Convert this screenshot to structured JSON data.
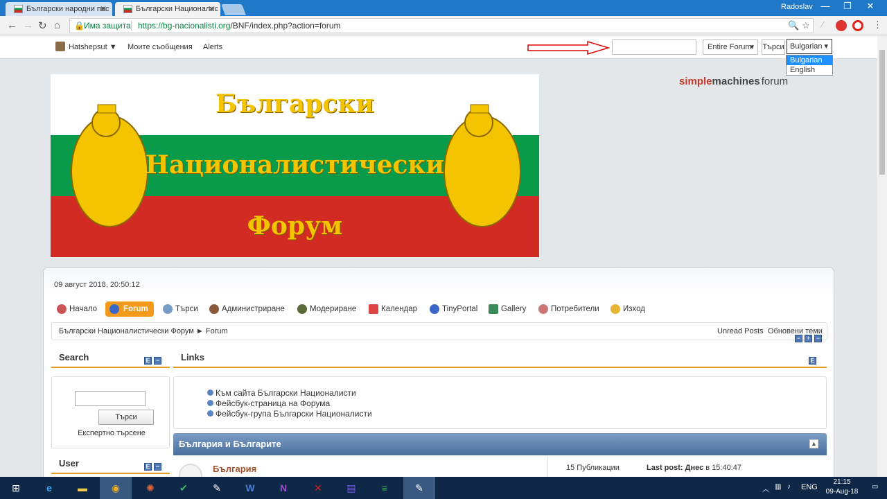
{
  "browser": {
    "tabs": [
      {
        "title": "Български народни пес"
      },
      {
        "title": "Български Националис"
      }
    ],
    "user": "Radoslav",
    "secure_label": "Има защита",
    "url_host": "https://bg-nacionalisti.org",
    "url_path": "/BNF/index.php?action=forum"
  },
  "userbar": {
    "username": "Hatshepsut ▼",
    "my_messages": "Моите съобщения",
    "alerts": "Alerts",
    "search_placeholder": "",
    "scope": "Entire Forum",
    "search_button": "Търси",
    "language_selected": "Bulgarian",
    "language_options": [
      "Bulgarian",
      "English"
    ]
  },
  "banner": {
    "line1": "Български",
    "line2": "Националистически",
    "line3": "Форум",
    "colors": {
      "white": "#ffffff",
      "green": "#0a9b4a",
      "red": "#d22b24",
      "gold": "#f5c400"
    }
  },
  "smf_logo": {
    "part1": "simple",
    "part2": "machines",
    "part3": "forum"
  },
  "forum": {
    "date": "09 август 2018, 20:50:12",
    "menu": [
      "Начало",
      "Forum",
      "Търси",
      "Администриране",
      "Модериране",
      "Календар",
      "TinyPortal",
      "Gallery",
      "Потребители",
      "Изход"
    ],
    "breadcrumb": "Български Националистически Форум ► Forum",
    "unread": "Unread Posts",
    "updated": "Обновени теми"
  },
  "search_block": {
    "title": "Search",
    "button": "Търси",
    "advanced": "Експертно търсене"
  },
  "user_block": {
    "title": "User"
  },
  "links_block": {
    "title": "Links",
    "items": [
      "Към сайта Български Националисти",
      "Фейсбук-страница на Форума",
      "Фейсбук-група Български Националисти"
    ]
  },
  "category": {
    "title": "България и Българите",
    "board_name": "България",
    "posts": "15 Публикации",
    "last_post_label": "Last post:",
    "last_post_day": "Днес",
    "last_post_rest": " в 15:40:47"
  },
  "taskbar": {
    "lang": "ENG",
    "time": "21:15",
    "date": "09-Aug-18"
  }
}
